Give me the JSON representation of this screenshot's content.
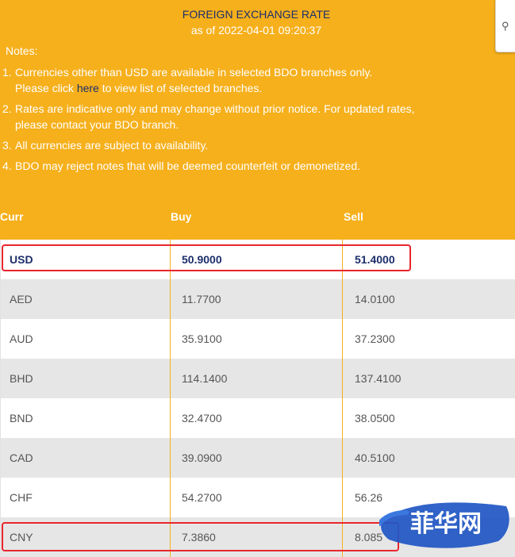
{
  "header": {
    "title": "FOREIGN EXCHANGE RATE",
    "subtitle": "as of 2022-04-01 09:20:37",
    "notes_heading": "Notes:"
  },
  "notes": [
    {
      "num": "1.",
      "line1": "Currencies other than USD are available in selected BDO branches only.",
      "line2_pre": "Please click ",
      "line2_link": "here",
      "line2_post": " to view list of selected branches."
    },
    {
      "num": "2.",
      "line1": "Rates are indicative only and may change without prior notice.  For updated rates,",
      "line2": "please contact your BDO branch."
    },
    {
      "num": "3.",
      "line1": "All currencies are subject to availability."
    },
    {
      "num": "4.",
      "line1": "BDO may reject notes that will be deemed counterfeit or demonetized."
    }
  ],
  "table": {
    "headers": {
      "curr": "Curr",
      "buy": "Buy",
      "sell": "Sell"
    },
    "rows": [
      {
        "curr": "USD",
        "buy": "50.9000",
        "sell": "51.4000",
        "bold": true
      },
      {
        "curr": "AED",
        "buy": "11.7700",
        "sell": "14.0100"
      },
      {
        "curr": "AUD",
        "buy": "35.9100",
        "sell": "37.2300"
      },
      {
        "curr": "BHD",
        "buy": "114.1400",
        "sell": "137.4100"
      },
      {
        "curr": "BND",
        "buy": "32.4700",
        "sell": "38.0500"
      },
      {
        "curr": "CAD",
        "buy": "39.0900",
        "sell": "40.5100"
      },
      {
        "curr": "CHF",
        "buy": "54.2700",
        "sell": "56.26"
      },
      {
        "curr": "CNY",
        "buy": "7.3860",
        "sell": "8.085"
      }
    ]
  },
  "colors": {
    "header_bg": "#f6b01c",
    "row_alt": "#e6e6e6",
    "highlight": "#e8262c",
    "text_navy": "#1c2f6b"
  },
  "watermark": {
    "text": "菲华网"
  }
}
